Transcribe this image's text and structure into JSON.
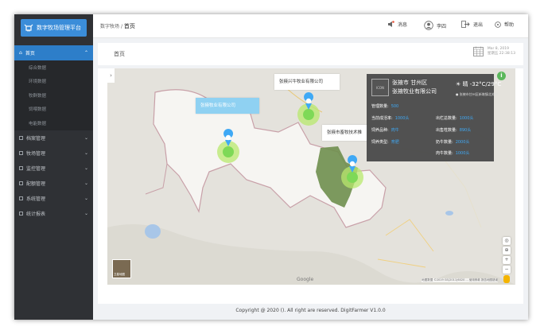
{
  "app": {
    "title": "数字牧场管理平台"
  },
  "sidebar": {
    "items": [
      {
        "label": "首页",
        "active": true,
        "children": [
          "综合数据",
          "环境数据",
          "牧群数据",
          "饲喂数据",
          "电能数据"
        ]
      },
      {
        "label": "档案管理"
      },
      {
        "label": "牧场管理"
      },
      {
        "label": "监控管理"
      },
      {
        "label": "配额管理"
      },
      {
        "label": "系统管理"
      },
      {
        "label": "统计报表"
      }
    ]
  },
  "header": {
    "crumb_parent": "数字牧场",
    "crumb_current": "首页",
    "news_label": "消息",
    "user_label": "李四",
    "logout_label": "退出",
    "help_label": "帮助"
  },
  "page": {
    "title": "首页",
    "date_line1": "Mar 8, 2019",
    "date_line2": "星期五 22:38:13"
  },
  "map": {
    "tip1": "张掖牧业有限公司",
    "tip2": "张掖兴牛牧业有限公司",
    "tip3": "张掖市畜牧技术推",
    "side_toggle": "›",
    "corner_label": "卫星地图",
    "attribution": "地图数据 ©2019 GS(2011)6020 ... 使用条款 报告地图错误",
    "google": "Google",
    "info": {
      "icon_text": "ICON",
      "city": "张掖市 甘州区",
      "company": "张掖牧业有限公司",
      "weather": "晴 -32°C/29°C",
      "tag": "张掖市甘州区新墩镇北关村",
      "rows": [
        {
          "label": "管理数量:",
          "value": "500"
        },
        {
          "label": "当前成活率:",
          "value": "1000头"
        },
        {
          "label": "出栏总数量:",
          "value": "1000头"
        },
        {
          "label": "饲养品种:",
          "value": "肉牛"
        },
        {
          "label": "出售牲数量:",
          "value": "890头"
        },
        {
          "label": "饲养类型:",
          "value": "育肥"
        },
        {
          "label": "奶牛数量:",
          "value": "2000头"
        },
        {
          "label": "肉牛数量:",
          "value": "1000头"
        }
      ]
    }
  },
  "footer": {
    "text": "Copyright @ 2020 (). All right are reserved. DigitFarmer V1.0.0"
  },
  "colors": {
    "accent": "#2d7ec9",
    "marker": "#7ed957",
    "pin": "#3fa9f5"
  }
}
